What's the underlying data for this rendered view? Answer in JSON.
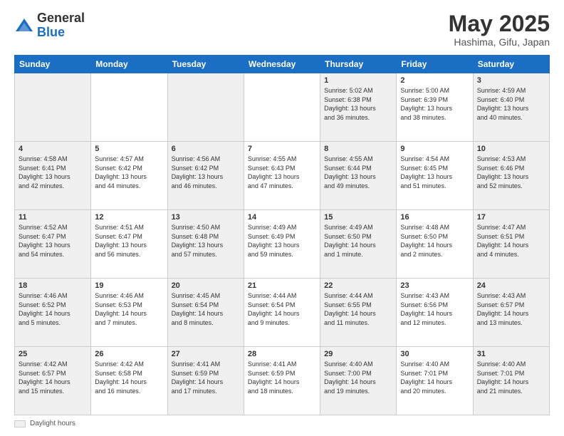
{
  "header": {
    "logo_general": "General",
    "logo_blue": "Blue",
    "month_title": "May 2025",
    "location": "Hashima, Gifu, Japan"
  },
  "days_of_week": [
    "Sunday",
    "Monday",
    "Tuesday",
    "Wednesday",
    "Thursday",
    "Friday",
    "Saturday"
  ],
  "weeks": [
    [
      {
        "day": "",
        "detail": ""
      },
      {
        "day": "",
        "detail": ""
      },
      {
        "day": "",
        "detail": ""
      },
      {
        "day": "",
        "detail": ""
      },
      {
        "day": "1",
        "detail": "Sunrise: 5:02 AM\nSunset: 6:38 PM\nDaylight: 13 hours\nand 36 minutes."
      },
      {
        "day": "2",
        "detail": "Sunrise: 5:00 AM\nSunset: 6:39 PM\nDaylight: 13 hours\nand 38 minutes."
      },
      {
        "day": "3",
        "detail": "Sunrise: 4:59 AM\nSunset: 6:40 PM\nDaylight: 13 hours\nand 40 minutes."
      }
    ],
    [
      {
        "day": "4",
        "detail": "Sunrise: 4:58 AM\nSunset: 6:41 PM\nDaylight: 13 hours\nand 42 minutes."
      },
      {
        "day": "5",
        "detail": "Sunrise: 4:57 AM\nSunset: 6:42 PM\nDaylight: 13 hours\nand 44 minutes."
      },
      {
        "day": "6",
        "detail": "Sunrise: 4:56 AM\nSunset: 6:42 PM\nDaylight: 13 hours\nand 46 minutes."
      },
      {
        "day": "7",
        "detail": "Sunrise: 4:55 AM\nSunset: 6:43 PM\nDaylight: 13 hours\nand 47 minutes."
      },
      {
        "day": "8",
        "detail": "Sunrise: 4:55 AM\nSunset: 6:44 PM\nDaylight: 13 hours\nand 49 minutes."
      },
      {
        "day": "9",
        "detail": "Sunrise: 4:54 AM\nSunset: 6:45 PM\nDaylight: 13 hours\nand 51 minutes."
      },
      {
        "day": "10",
        "detail": "Sunrise: 4:53 AM\nSunset: 6:46 PM\nDaylight: 13 hours\nand 52 minutes."
      }
    ],
    [
      {
        "day": "11",
        "detail": "Sunrise: 4:52 AM\nSunset: 6:47 PM\nDaylight: 13 hours\nand 54 minutes."
      },
      {
        "day": "12",
        "detail": "Sunrise: 4:51 AM\nSunset: 6:47 PM\nDaylight: 13 hours\nand 56 minutes."
      },
      {
        "day": "13",
        "detail": "Sunrise: 4:50 AM\nSunset: 6:48 PM\nDaylight: 13 hours\nand 57 minutes."
      },
      {
        "day": "14",
        "detail": "Sunrise: 4:49 AM\nSunset: 6:49 PM\nDaylight: 13 hours\nand 59 minutes."
      },
      {
        "day": "15",
        "detail": "Sunrise: 4:49 AM\nSunset: 6:50 PM\nDaylight: 14 hours\nand 1 minute."
      },
      {
        "day": "16",
        "detail": "Sunrise: 4:48 AM\nSunset: 6:50 PM\nDaylight: 14 hours\nand 2 minutes."
      },
      {
        "day": "17",
        "detail": "Sunrise: 4:47 AM\nSunset: 6:51 PM\nDaylight: 14 hours\nand 4 minutes."
      }
    ],
    [
      {
        "day": "18",
        "detail": "Sunrise: 4:46 AM\nSunset: 6:52 PM\nDaylight: 14 hours\nand 5 minutes."
      },
      {
        "day": "19",
        "detail": "Sunrise: 4:46 AM\nSunset: 6:53 PM\nDaylight: 14 hours\nand 7 minutes."
      },
      {
        "day": "20",
        "detail": "Sunrise: 4:45 AM\nSunset: 6:54 PM\nDaylight: 14 hours\nand 8 minutes."
      },
      {
        "day": "21",
        "detail": "Sunrise: 4:44 AM\nSunset: 6:54 PM\nDaylight: 14 hours\nand 9 minutes."
      },
      {
        "day": "22",
        "detail": "Sunrise: 4:44 AM\nSunset: 6:55 PM\nDaylight: 14 hours\nand 11 minutes."
      },
      {
        "day": "23",
        "detail": "Sunrise: 4:43 AM\nSunset: 6:56 PM\nDaylight: 14 hours\nand 12 minutes."
      },
      {
        "day": "24",
        "detail": "Sunrise: 4:43 AM\nSunset: 6:57 PM\nDaylight: 14 hours\nand 13 minutes."
      }
    ],
    [
      {
        "day": "25",
        "detail": "Sunrise: 4:42 AM\nSunset: 6:57 PM\nDaylight: 14 hours\nand 15 minutes."
      },
      {
        "day": "26",
        "detail": "Sunrise: 4:42 AM\nSunset: 6:58 PM\nDaylight: 14 hours\nand 16 minutes."
      },
      {
        "day": "27",
        "detail": "Sunrise: 4:41 AM\nSunset: 6:59 PM\nDaylight: 14 hours\nand 17 minutes."
      },
      {
        "day": "28",
        "detail": "Sunrise: 4:41 AM\nSunset: 6:59 PM\nDaylight: 14 hours\nand 18 minutes."
      },
      {
        "day": "29",
        "detail": "Sunrise: 4:40 AM\nSunset: 7:00 PM\nDaylight: 14 hours\nand 19 minutes."
      },
      {
        "day": "30",
        "detail": "Sunrise: 4:40 AM\nSunset: 7:01 PM\nDaylight: 14 hours\nand 20 minutes."
      },
      {
        "day": "31",
        "detail": "Sunrise: 4:40 AM\nSunset: 7:01 PM\nDaylight: 14 hours\nand 21 minutes."
      }
    ]
  ],
  "footer": {
    "legend_label": "Daylight hours"
  }
}
